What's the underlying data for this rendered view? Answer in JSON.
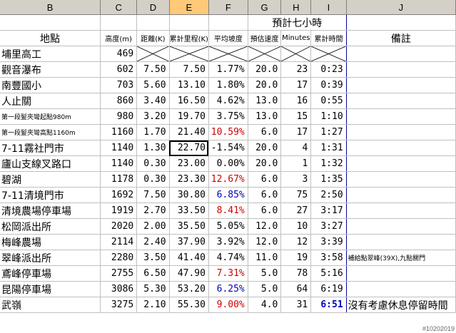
{
  "columns": [
    "B",
    "C",
    "D",
    "E",
    "F",
    "G",
    "H",
    "I",
    "J"
  ],
  "selected_column": "E",
  "header_top": {
    "group_label": "預計七小時"
  },
  "header": {
    "location": "地點",
    "altitude": "高度(m)",
    "distance": "距離(K)",
    "cumulative": "累計里程(K)",
    "slope": "平均坡度",
    "speed": "預估速度",
    "minutes": "Minutes",
    "cum_time": "累計時間",
    "notes": "備註"
  },
  "rows": [
    {
      "name": "埔里高工",
      "alt": "469",
      "dist": "",
      "cum": "",
      "slope": "",
      "speed": "",
      "min": "",
      "time": "",
      "note": "",
      "crossed": true
    },
    {
      "name": "觀音瀑布",
      "alt": "602",
      "dist": "7.50",
      "cum": "7.50",
      "slope": "1.77%",
      "speed": "20.0",
      "min": "23",
      "time": "0:23",
      "note": ""
    },
    {
      "name": "南豐國小",
      "alt": "703",
      "dist": "5.60",
      "cum": "13.10",
      "slope": "1.80%",
      "speed": "20.0",
      "min": "17",
      "time": "0:39",
      "note": ""
    },
    {
      "name": "人止關",
      "alt": "860",
      "dist": "3.40",
      "cum": "16.50",
      "slope": "4.62%",
      "speed": "13.0",
      "min": "16",
      "time": "0:55",
      "note": ""
    },
    {
      "name": "第一段髮夾彎起點980m",
      "alt": "980",
      "dist": "3.20",
      "cum": "19.70",
      "slope": "3.75%",
      "speed": "13.0",
      "min": "15",
      "time": "1:10",
      "note": "",
      "small": true
    },
    {
      "name": "第一段髮夾彎高點1160m",
      "alt": "1160",
      "dist": "1.70",
      "cum": "21.40",
      "slope": "10.59%",
      "speed": "6.0",
      "min": "17",
      "time": "1:27",
      "note": "",
      "small": true,
      "slopeColor": "red"
    },
    {
      "name": "7-11霧社門市",
      "alt": "1140",
      "dist": "1.30",
      "cum": "22.70",
      "slope": "-1.54%",
      "speed": "20.0",
      "min": "4",
      "time": "1:31",
      "note": "",
      "active": true
    },
    {
      "name": "廬山支線叉路口",
      "alt": "1140",
      "dist": "0.30",
      "cum": "23.00",
      "slope": "0.00%",
      "speed": "20.0",
      "min": "1",
      "time": "1:32",
      "note": ""
    },
    {
      "name": "碧湖",
      "alt": "1178",
      "dist": "0.30",
      "cum": "23.30",
      "slope": "12.67%",
      "speed": "6.0",
      "min": "3",
      "time": "1:35",
      "note": "",
      "slopeColor": "red"
    },
    {
      "name": "7-11清境門市",
      "alt": "1692",
      "dist": "7.50",
      "cum": "30.80",
      "slope": "6.85%",
      "speed": "6.0",
      "min": "75",
      "time": "2:50",
      "note": "",
      "slopeColor": "blue"
    },
    {
      "name": "清境農場停車場",
      "alt": "1919",
      "dist": "2.70",
      "cum": "33.50",
      "slope": "8.41%",
      "speed": "6.0",
      "min": "27",
      "time": "3:17",
      "note": "",
      "slopeColor": "red"
    },
    {
      "name": "松岡派出所",
      "alt": "2020",
      "dist": "2.00",
      "cum": "35.50",
      "slope": "5.05%",
      "speed": "12.0",
      "min": "10",
      "time": "3:27",
      "note": ""
    },
    {
      "name": "梅峰農場",
      "alt": "2114",
      "dist": "2.40",
      "cum": "37.90",
      "slope": "3.92%",
      "speed": "12.0",
      "min": "12",
      "time": "3:39",
      "note": ""
    },
    {
      "name": "翠峰派出所",
      "alt": "2280",
      "dist": "3.50",
      "cum": "41.40",
      "slope": "4.74%",
      "speed": "11.0",
      "min": "19",
      "time": "3:58",
      "note": "補給點翠峰(39X),九點關門"
    },
    {
      "name": "鳶峰停車場",
      "alt": "2755",
      "dist": "6.50",
      "cum": "47.90",
      "slope": "7.31%",
      "speed": "5.0",
      "min": "78",
      "time": "5:16",
      "note": "",
      "slopeColor": "red"
    },
    {
      "name": "昆陽停車場",
      "alt": "3086",
      "dist": "5.30",
      "cum": "53.20",
      "slope": "6.25%",
      "speed": "5.0",
      "min": "64",
      "time": "6:19",
      "note": "",
      "slopeColor": "blue"
    },
    {
      "name": "武嶺",
      "alt": "3275",
      "dist": "2.10",
      "cum": "55.30",
      "slope": "9.00%",
      "speed": "4.0",
      "min": "31",
      "time": "6:51",
      "note": "沒有考慮休息停留時間",
      "slopeColor": "red",
      "timeColor": "blue",
      "timeBold": true
    }
  ],
  "watermark": "#10202019"
}
